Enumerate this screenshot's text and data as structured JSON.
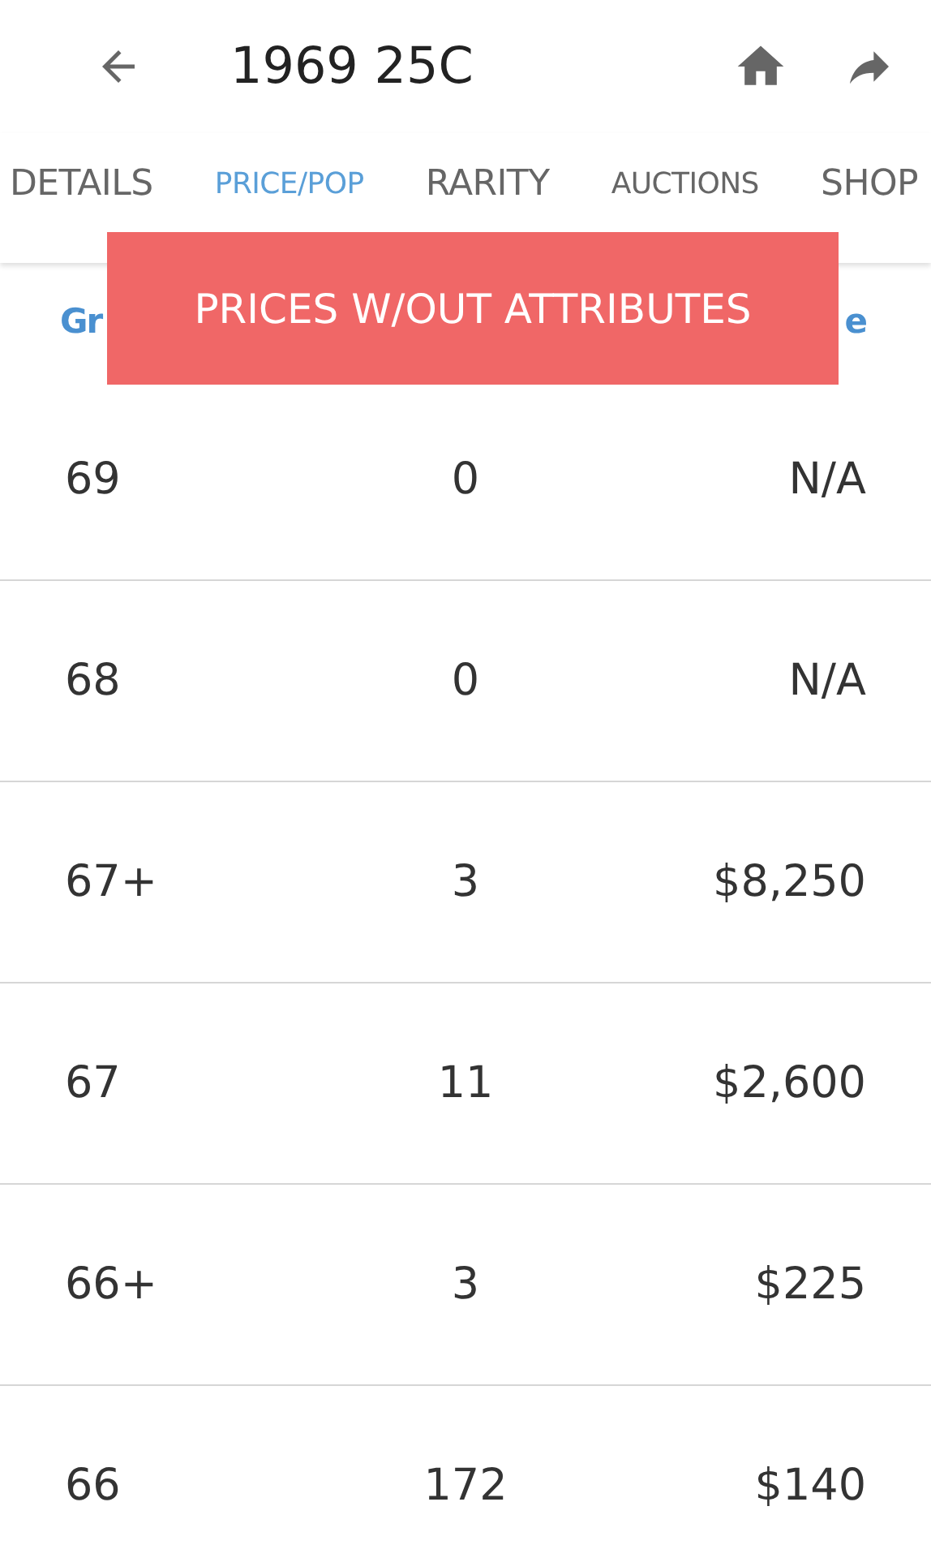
{
  "header": {
    "title": "1969 25C"
  },
  "tabs": [
    {
      "label": "DETAILS",
      "selected": false,
      "kind": "normal"
    },
    {
      "label": "PRICE/POP",
      "selected": true,
      "kind": "small"
    },
    {
      "label": "RARITY",
      "selected": false,
      "kind": "normal"
    },
    {
      "label": "AUCTIONS",
      "selected": false,
      "kind": "small"
    },
    {
      "label": "SHOP",
      "selected": false,
      "kind": "normal"
    }
  ],
  "table": {
    "header_row": {
      "column_1": "Gr",
      "column_3": "e"
    },
    "rows": [
      [
        "69",
        "0",
        "N/A"
      ],
      [
        "68",
        "0",
        "N/A"
      ],
      [
        "67+",
        "3",
        "$8,250"
      ],
      [
        "67",
        "11",
        "$2,600"
      ],
      [
        "66+",
        "3",
        "$225"
      ],
      [
        "66",
        "172",
        "$140"
      ]
    ]
  },
  "toast": {
    "text": "PRICES W/OUT ATTRIBUTES"
  }
}
